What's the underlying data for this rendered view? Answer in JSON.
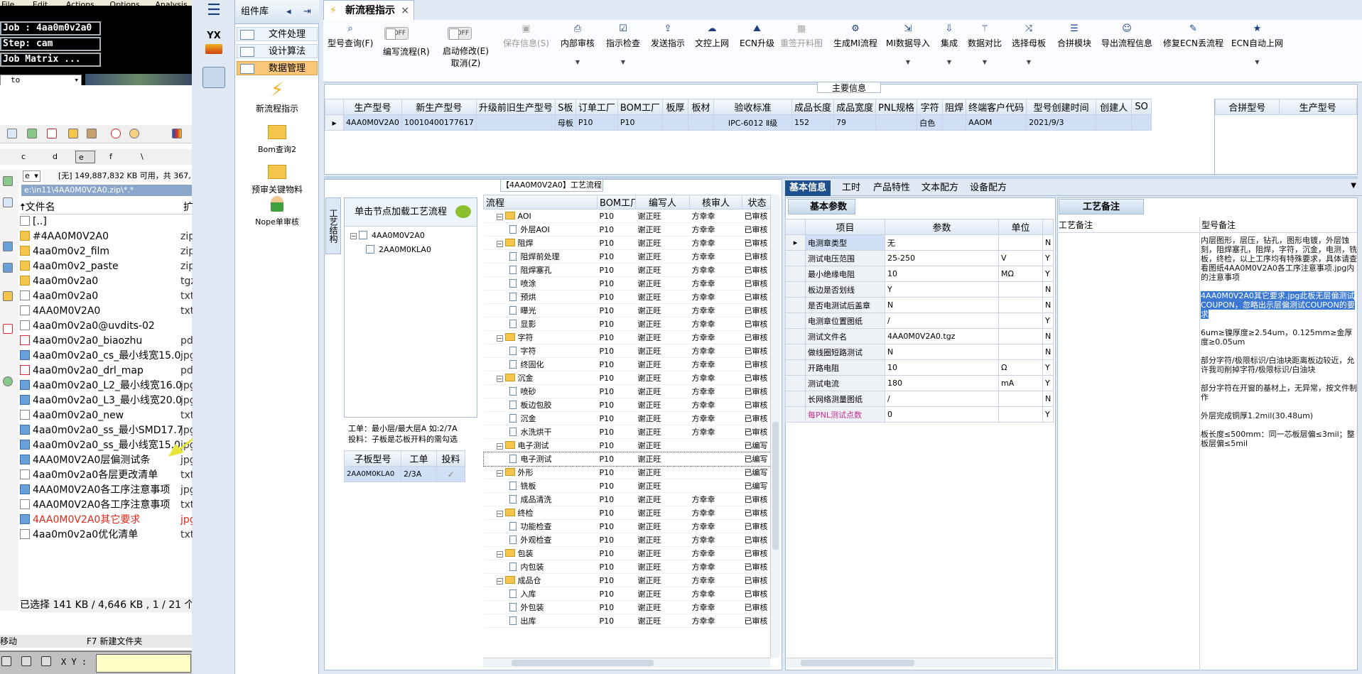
{
  "left_window": {
    "menu": [
      "File",
      "Edit",
      "Actions",
      "Options",
      "Analysis"
    ],
    "job_panel": {
      "job": "Job : 4aa0m0v2a0",
      "step": "Step: cam",
      "matrix": "Job Matrix ...",
      "to_value": "to"
    },
    "drives": [
      "c",
      "d",
      "e",
      "f",
      "\\"
    ],
    "drive_select": "e",
    "disk_info": "[无] 149,887,832 KB 可用，共 367,",
    "path": "e:\\in11\\4AA0M0V2A0.zip\\*.*",
    "column_header": "文件名",
    "column_header_ext": "扩",
    "files": [
      {
        "name": "[..]",
        "ext": "",
        "icon": "up-icon"
      },
      {
        "name": "#4AA0M0V2A0",
        "ext": "zip",
        "icon": "folder-icon"
      },
      {
        "name": "4aa0m0v2_film",
        "ext": "zip",
        "icon": "folder-icon"
      },
      {
        "name": "4aa0m0v2_paste",
        "ext": "zip",
        "icon": "folder-icon"
      },
      {
        "name": "4aa0m0v2a0",
        "ext": "tgz",
        "icon": "folder-icon"
      },
      {
        "name": "4aa0m0v2a0",
        "ext": "txt",
        "icon": "file-icon"
      },
      {
        "name": "4AA0M0V2A0",
        "ext": "txt",
        "icon": "file-icon"
      },
      {
        "name": "4aa0m0v2a0@uvdits-02",
        "ext": "",
        "icon": "file-icon"
      },
      {
        "name": "4aa0m0v2a0_biaozhu",
        "ext": "pdf",
        "icon": "pdf-icon"
      },
      {
        "name": "4aa0m0v2a0_cs_最小线宽15.0",
        "ext": "jpg",
        "icon": "image-icon"
      },
      {
        "name": "4aa0m0v2a0_drl_map",
        "ext": "pdf",
        "icon": "pdf-icon"
      },
      {
        "name": "4aa0m0v2a0_L2_最小线宽16.0",
        "ext": "jpg",
        "icon": "image-icon"
      },
      {
        "name": "4aa0m0v2a0_L3_最小线宽20.0",
        "ext": "jpg",
        "icon": "image-icon"
      },
      {
        "name": "4aa0m0v2a0_new",
        "ext": "txt",
        "icon": "file-icon"
      },
      {
        "name": "4aa0m0v2a0_ss_最小SMD17.7",
        "ext": "jpg",
        "icon": "image-icon"
      },
      {
        "name": "4aa0m0v2a0_ss_最小线宽15.0",
        "ext": "jpg",
        "icon": "image-icon"
      },
      {
        "name": "4AA0M0V2A0层偏测试条",
        "ext": "jpg",
        "icon": "image-icon"
      },
      {
        "name": "4aa0m0v2a0各层更改清单",
        "ext": "txt",
        "icon": "file-icon"
      },
      {
        "name": "4AA0M0V2A0各工序注意事项",
        "ext": "jpg",
        "icon": "image-icon"
      },
      {
        "name": "4AA0M0V2A0各工序注意事项",
        "ext": "txt",
        "icon": "file-icon"
      },
      {
        "name": "4AA0M0V2A0其它要求",
        "ext": "jpg",
        "icon": "image-icon",
        "highlight": true
      },
      {
        "name": "4aa0m0v2a0优化清单",
        "ext": "txt",
        "icon": "file-icon"
      }
    ],
    "status": "已选择 141 KB / 4,646 KB , 1 / 21 个",
    "fkeys": {
      "move": "移动",
      "newfolder": "F7 新建文件夹"
    },
    "xy_label": "X Y :"
  },
  "sidebar": {
    "logo": "YX"
  },
  "component_panel": {
    "title": "组件库",
    "menus": [
      {
        "label": "文件处理",
        "selected": false
      },
      {
        "label": "设计算法",
        "selected": false
      },
      {
        "label": "数据管理",
        "selected": true
      }
    ],
    "tools": [
      {
        "label": "新流程指示",
        "icon": "lightning-icon"
      },
      {
        "label": "Bom查询2",
        "icon": "folder-icon"
      },
      {
        "label": "预审关键物料",
        "icon": "folder-icon"
      },
      {
        "label": "Nope单审核",
        "icon": "user-icon"
      }
    ]
  },
  "doc_tab": {
    "title": "新流程指示",
    "close": "×"
  },
  "toolbar": {
    "buttons": [
      {
        "label": "型号查询(F)",
        "icon": "search-icon",
        "dropdown": false,
        "disabled": false
      },
      {
        "label": "编写流程(R)",
        "toggle": "OFF"
      },
      {
        "label": "启动修改(E)",
        "label2": "取消(Z)",
        "toggle": "OFF"
      },
      {
        "label": "保存信息(S)",
        "icon": "save-icon",
        "disabled": true
      },
      {
        "label": "内部审核",
        "icon": "print-icon",
        "dropdown": true
      },
      {
        "label": "指示检查",
        "icon": "check-icon",
        "dropdown": true
      },
      {
        "label": "发送指示",
        "icon": "upload-icon"
      },
      {
        "label": "文控上网",
        "icon": "cloud-icon"
      },
      {
        "label": "ECN升级",
        "icon": "ecn-icon"
      },
      {
        "label": "重签开料图",
        "icon": "image-icon",
        "disabled": true
      },
      {
        "label": "生成MI流程",
        "icon": "gears-icon"
      },
      {
        "label": "MI数据导入",
        "icon": "import-icon",
        "dropdown": true
      },
      {
        "label": "集成",
        "icon": "download-icon",
        "dropdown": true
      },
      {
        "label": "数据对比",
        "icon": "wand-icon",
        "dropdown": true
      },
      {
        "label": "选择母板",
        "icon": "shuffle-icon",
        "dropdown": true
      },
      {
        "label": "合拼模块",
        "icon": "list-icon"
      },
      {
        "label": "导出流程信息",
        "icon": "smile-icon"
      },
      {
        "label": "修复ECN丢流程",
        "icon": "wrench-icon"
      },
      {
        "label": "ECN自动上网",
        "icon": "star-icon",
        "dropdown": true
      }
    ]
  },
  "main_info": {
    "title": "主要信息",
    "headers": [
      "生产型号",
      "新生产型号",
      "升级前旧生产型号",
      "S板",
      "订单工厂",
      "BOM工厂",
      "板厚",
      "板材",
      "验收标准",
      "成品长度",
      "成品宽度",
      "PNL规格",
      "字符",
      "阻焊",
      "终端客户代码",
      "型号创建时间",
      "创建人",
      "SO"
    ],
    "row": [
      "4AA0M0V2A0",
      "10010400177617",
      "",
      "母板",
      "P10",
      "P10",
      "",
      "",
      "IPC-6012 Ⅱ级",
      "152",
      "79",
      "",
      "白色",
      "",
      "AAOM",
      "2021/9/3",
      "",
      ""
    ],
    "side_headers": [
      "合拼型号",
      "生产型号"
    ]
  },
  "process": {
    "title": "【4AA0M0V2A0】工艺流程",
    "vtab": "工艺结构",
    "tree_header": "单击节点加载工艺流程",
    "tree_nodes": [
      "4AA0M0V2A0",
      "2AA0M0KLA0"
    ],
    "note_line1": "工单：最小层/最大层A 如:2/7A",
    "note_line2": "投料：子板是芯板开料的需勾选",
    "sub_headers": [
      "子板型号",
      "工单",
      "投料"
    ],
    "sub_row": [
      "2AA0M0KLA0",
      "2/3A",
      "✓"
    ],
    "grid_headers": [
      "流程",
      "BOM工厂",
      "编写人",
      "核审人",
      "状态"
    ],
    "rows": [
      {
        "name": "AOI",
        "level": 1,
        "folder": true,
        "bom": "P10",
        "writer": "谢正旺",
        "reviewer": "方幸幸",
        "status": "已审核"
      },
      {
        "name": "外层AOI",
        "level": 2,
        "folder": false,
        "bom": "P10",
        "writer": "谢正旺",
        "reviewer": "方幸幸",
        "status": "已审核"
      },
      {
        "name": "阻焊",
        "level": 1,
        "folder": true,
        "bom": "P10",
        "writer": "谢正旺",
        "reviewer": "方幸幸",
        "status": "已审核"
      },
      {
        "name": "阻焊前处理",
        "level": 2,
        "folder": false,
        "bom": "P10",
        "writer": "谢正旺",
        "reviewer": "方幸幸",
        "status": "已审核"
      },
      {
        "name": "阻焊塞孔",
        "level": 2,
        "folder": false,
        "bom": "P10",
        "writer": "谢正旺",
        "reviewer": "方幸幸",
        "status": "已审核"
      },
      {
        "name": "喷涂",
        "level": 2,
        "folder": false,
        "bom": "P10",
        "writer": "谢正旺",
        "reviewer": "方幸幸",
        "status": "已审核"
      },
      {
        "name": "预烘",
        "level": 2,
        "folder": false,
        "bom": "P10",
        "writer": "谢正旺",
        "reviewer": "方幸幸",
        "status": "已审核"
      },
      {
        "name": "曝光",
        "level": 2,
        "folder": false,
        "bom": "P10",
        "writer": "谢正旺",
        "reviewer": "方幸幸",
        "status": "已审核"
      },
      {
        "name": "显影",
        "level": 2,
        "folder": false,
        "bom": "P10",
        "writer": "谢正旺",
        "reviewer": "方幸幸",
        "status": "已审核"
      },
      {
        "name": "字符",
        "level": 1,
        "folder": true,
        "bom": "P10",
        "writer": "谢正旺",
        "reviewer": "方幸幸",
        "status": "已审核"
      },
      {
        "name": "字符",
        "level": 2,
        "folder": false,
        "bom": "P10",
        "writer": "谢正旺",
        "reviewer": "方幸幸",
        "status": "已审核"
      },
      {
        "name": "终固化",
        "level": 2,
        "folder": false,
        "bom": "P10",
        "writer": "谢正旺",
        "reviewer": "方幸幸",
        "status": "已审核"
      },
      {
        "name": "沉金",
        "level": 1,
        "folder": true,
        "bom": "P10",
        "writer": "谢正旺",
        "reviewer": "方幸幸",
        "status": "已审核"
      },
      {
        "name": "喷砂",
        "level": 2,
        "folder": false,
        "bom": "P10",
        "writer": "谢正旺",
        "reviewer": "方幸幸",
        "status": "已审核"
      },
      {
        "name": "板边包胶",
        "level": 2,
        "folder": false,
        "bom": "P10",
        "writer": "谢正旺",
        "reviewer": "方幸幸",
        "status": "已审核"
      },
      {
        "name": "沉金",
        "level": 2,
        "folder": false,
        "bom": "P10",
        "writer": "谢正旺",
        "reviewer": "方幸幸",
        "status": "已审核"
      },
      {
        "name": "水洗烘干",
        "level": 2,
        "folder": false,
        "bom": "P10",
        "writer": "谢正旺",
        "reviewer": "方幸幸",
        "status": "已审核"
      },
      {
        "name": "电子测试",
        "level": 1,
        "folder": true,
        "bom": "P10",
        "writer": "谢正旺",
        "reviewer": "",
        "status": "已编写"
      },
      {
        "name": "电子测试",
        "level": 2,
        "folder": false,
        "bom": "P10",
        "writer": "谢正旺",
        "reviewer": "",
        "status": "已编写",
        "selected": true
      },
      {
        "name": "外形",
        "level": 1,
        "folder": true,
        "bom": "P10",
        "writer": "谢正旺",
        "reviewer": "",
        "status": "已编写"
      },
      {
        "name": "铣板",
        "level": 2,
        "folder": false,
        "bom": "P10",
        "writer": "谢正旺",
        "reviewer": "",
        "status": "已编写"
      },
      {
        "name": "成品清洗",
        "level": 2,
        "folder": false,
        "bom": "P10",
        "writer": "谢正旺",
        "reviewer": "方幸幸",
        "status": "已审核"
      },
      {
        "name": "终检",
        "level": 1,
        "folder": true,
        "bom": "P10",
        "writer": "谢正旺",
        "reviewer": "方幸幸",
        "status": "已审核"
      },
      {
        "name": "功能检查",
        "level": 2,
        "folder": false,
        "bom": "P10",
        "writer": "谢正旺",
        "reviewer": "方幸幸",
        "status": "已审核"
      },
      {
        "name": "外观检查",
        "level": 2,
        "folder": false,
        "bom": "P10",
        "writer": "谢正旺",
        "reviewer": "方幸幸",
        "status": "已审核"
      },
      {
        "name": "包装",
        "level": 1,
        "folder": true,
        "bom": "P10",
        "writer": "谢正旺",
        "reviewer": "方幸幸",
        "status": "已审核"
      },
      {
        "name": "内包装",
        "level": 2,
        "folder": false,
        "bom": "P10",
        "writer": "谢正旺",
        "reviewer": "方幸幸",
        "status": "已审核"
      },
      {
        "name": "成品仓",
        "level": 1,
        "folder": true,
        "bom": "P10",
        "writer": "谢正旺",
        "reviewer": "方幸幸",
        "status": "已审核"
      },
      {
        "name": "入库",
        "level": 2,
        "folder": false,
        "bom": "P10",
        "writer": "谢正旺",
        "reviewer": "方幸幸",
        "status": "已审核"
      },
      {
        "name": "外包装",
        "level": 2,
        "folder": false,
        "bom": "P10",
        "writer": "谢正旺",
        "reviewer": "方幸幸",
        "status": "已审核"
      },
      {
        "name": "出库",
        "level": 2,
        "folder": false,
        "bom": "P10",
        "writer": "谢正旺",
        "reviewer": "方幸幸",
        "status": "已审核"
      }
    ]
  },
  "basic_info": {
    "tabs": [
      "基本信息",
      "工时",
      "产品特性",
      "文本配方",
      "设备配方"
    ],
    "title": "基本参数",
    "headers": [
      "项目",
      "参数",
      "单位"
    ],
    "rows": [
      {
        "item": "电测章类型",
        "param": "无",
        "unit": "",
        "flag": "N",
        "active": true
      },
      {
        "item": "测试电压范围",
        "param": "25-250",
        "unit": "V",
        "flag": "Y"
      },
      {
        "item": "最小绝缘电阻",
        "param": "10",
        "unit": "MΩ",
        "flag": "Y"
      },
      {
        "item": "板边是否划线",
        "param": "Y",
        "unit": "",
        "flag": "N"
      },
      {
        "item": "是否电测试后盖章",
        "param": "N",
        "unit": "",
        "flag": "N"
      },
      {
        "item": "电测章位置图纸",
        "param": "/",
        "unit": "",
        "flag": "Y"
      },
      {
        "item": "测试文件名",
        "param": "4AA0M0V2A0.tgz",
        "unit": "",
        "flag": "N"
      },
      {
        "item": "做线圈短路测试",
        "param": "N",
        "unit": "",
        "flag": "N"
      },
      {
        "item": "开路电阻",
        "param": "10",
        "unit": "Ω",
        "flag": "Y"
      },
      {
        "item": "测试电流",
        "param": "180",
        "unit": "mA",
        "flag": "Y"
      },
      {
        "item": "长网络测量图纸",
        "param": "/",
        "unit": "",
        "flag": "N"
      },
      {
        "item": "每PNL测试点数",
        "param": "0",
        "unit": "",
        "flag": "Y",
        "pink": true
      }
    ]
  },
  "notes": {
    "title": "工艺备注",
    "col1": "工艺备注",
    "col2": "型号备注",
    "p1": "内层图形，层压，钻孔，图形电镀，外层蚀刻，阻焊塞孔，阻焊，字符，沉金，电测，铣板，终检，以上工序均有特殊要求，具体请查看图纸4AA0M0V2A0各工序注意事项.jpg内的注意事项",
    "p2": "4AA0M0V2A0其它要求.jpg此板无层偏测试COUPON，忽略出示层偏测试COUPON的要求",
    "p3": "6um≥镍厚度≥2.54um，0.125mm≥金厚度≥0.05um",
    "p4": "部分字符/极限标识/白油块距离板边较近，允许我司削掉字符/极限标识/白油块",
    "p5": "部分字符在开窗的基材上，无异常，按文件制作",
    "p6": "外层完成铜厚1.2mil(30.48um)",
    "p7": "板长度≤500mm：同一芯板层偏≤3mil；整板层偏≤5mil"
  },
  "colors": {
    "accent": "#1c4f8c",
    "selected_row": "#cfe0f6",
    "highlight_menu": "#f9c77a",
    "annotation_arrow": "#e6e63a"
  }
}
